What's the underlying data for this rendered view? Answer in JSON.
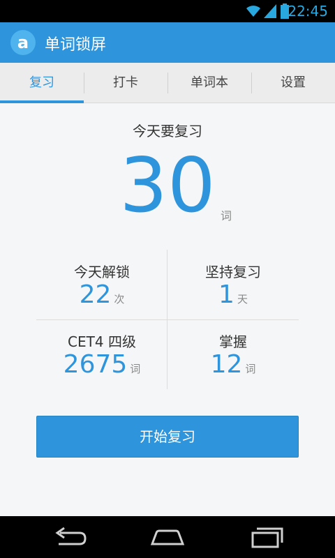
{
  "status": {
    "time": "22:45",
    "icons": [
      "wifi-icon",
      "signal-icon",
      "battery-icon"
    ]
  },
  "app": {
    "title": "单词锁屏",
    "logo": "a"
  },
  "tabs": [
    {
      "label": "复习"
    },
    {
      "label": "打卡"
    },
    {
      "label": "单词本"
    },
    {
      "label": "设置"
    }
  ],
  "review": {
    "heading": "今天要复习",
    "count": "30",
    "unit": "词"
  },
  "stats": [
    {
      "label": "今天解锁",
      "value": "22",
      "unit": "次"
    },
    {
      "label": "坚持复习",
      "value": "1",
      "unit": "天"
    },
    {
      "label": "CET4 四级",
      "value": "2675",
      "unit": "词"
    },
    {
      "label": "掌握",
      "value": "12",
      "unit": "词"
    }
  ],
  "start_button": "开始复习",
  "colors": {
    "accent": "#2e95dc",
    "status_time": "#29a8e0"
  }
}
